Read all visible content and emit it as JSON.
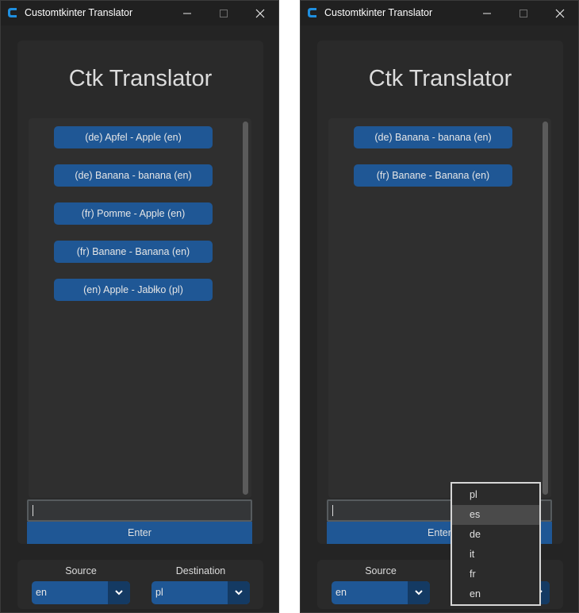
{
  "windows": [
    {
      "title": "Customtkinter Translator",
      "app_title": "Ctk Translator",
      "entries": [
        "(de) Apfel - Apple (en)",
        "(de) Banana - banana (en)",
        "(fr) Pomme - Apple (en)",
        "(fr) Banane - Banana (en)",
        "(en) Apple - Jabłko (pl)"
      ],
      "input_value": "",
      "enter_label": "Enter",
      "source_label": "Source",
      "source_value": "en",
      "destination_label": "Destination",
      "destination_value": "pl"
    },
    {
      "title": "Customtkinter Translator",
      "app_title": "Ctk Translator",
      "entries": [
        "(de) Banana - banana (en)",
        "(fr) Banane - Banana (en)"
      ],
      "input_value": "",
      "enter_label": "Enter",
      "source_label": "Source",
      "source_value": "en",
      "dropdown_options": [
        "pl",
        "es",
        "de",
        "it",
        "fr",
        "en"
      ],
      "dropdown_highlighted": "es"
    }
  ],
  "colors": {
    "accent": "#1f5795",
    "accent_dark": "#143a63",
    "window_bg": "#242424",
    "frame_bg": "#2a2a2a",
    "app_icon": "#1f8fe0"
  },
  "icons": {
    "app": "customtkinter-logo-icon",
    "minimize": "minimize-icon",
    "maximize": "maximize-icon",
    "close": "close-icon",
    "dropdown": "chevron-down-icon"
  }
}
